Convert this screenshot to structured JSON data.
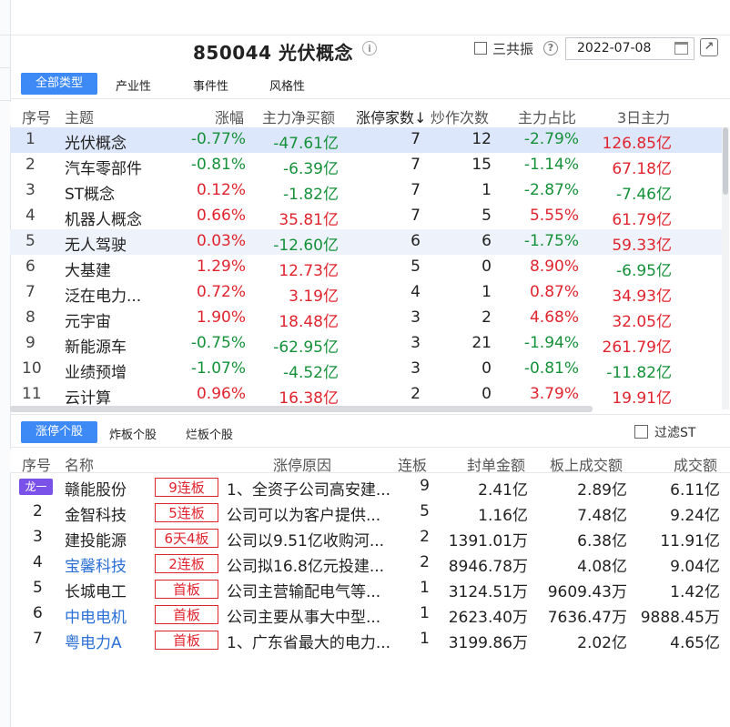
{
  "header": {
    "title": "850044 光伏概念",
    "resonance_label": "三共振",
    "date": "2022-07-08"
  },
  "type_tabs": [
    "全部类型",
    "产业性",
    "事件性",
    "风格性"
  ],
  "concept_table": {
    "columns": [
      "序号",
      "主题",
      "涨幅",
      "主力净买额",
      "涨停家数↓",
      "炒作次数",
      "主力占比",
      "3日主力"
    ],
    "rows": [
      {
        "idx": "1",
        "name": "光伏概念",
        "chg": "-0.77%",
        "net": "-47.61亿",
        "limit_up": "7",
        "hype": "12",
        "ratio": "-2.79%",
        "d3": "126.85亿"
      },
      {
        "idx": "2",
        "name": "汽车零部件",
        "chg": "-0.81%",
        "net": "-6.39亿",
        "limit_up": "7",
        "hype": "15",
        "ratio": "-1.14%",
        "d3": "67.18亿"
      },
      {
        "idx": "3",
        "name": "ST概念",
        "chg": "0.12%",
        "net": "-1.82亿",
        "limit_up": "7",
        "hype": "1",
        "ratio": "-2.87%",
        "d3": "-7.46亿"
      },
      {
        "idx": "4",
        "name": "机器人概念",
        "chg": "0.66%",
        "net": "35.81亿",
        "limit_up": "7",
        "hype": "5",
        "ratio": "5.55%",
        "d3": "61.79亿"
      },
      {
        "idx": "5",
        "name": "无人驾驶",
        "chg": "0.03%",
        "net": "-12.60亿",
        "limit_up": "6",
        "hype": "6",
        "ratio": "-1.75%",
        "d3": "59.33亿"
      },
      {
        "idx": "6",
        "name": "大基建",
        "chg": "1.29%",
        "net": "12.73亿",
        "limit_up": "5",
        "hype": "0",
        "ratio": "8.90%",
        "d3": "-6.95亿"
      },
      {
        "idx": "7",
        "name": "泛在电力...",
        "chg": "0.72%",
        "net": "3.19亿",
        "limit_up": "4",
        "hype": "1",
        "ratio": "0.87%",
        "d3": "34.93亿"
      },
      {
        "idx": "8",
        "name": "元宇宙",
        "chg": "1.90%",
        "net": "18.48亿",
        "limit_up": "3",
        "hype": "2",
        "ratio": "4.68%",
        "d3": "32.05亿"
      },
      {
        "idx": "9",
        "name": "新能源车",
        "chg": "-0.75%",
        "net": "-62.95亿",
        "limit_up": "3",
        "hype": "21",
        "ratio": "-1.94%",
        "d3": "261.79亿"
      },
      {
        "idx": "10",
        "name": "业绩预增",
        "chg": "-1.07%",
        "net": "-4.52亿",
        "limit_up": "3",
        "hype": "0",
        "ratio": "-0.81%",
        "d3": "-11.82亿"
      },
      {
        "idx": "11",
        "name": "云计算",
        "chg": "0.96%",
        "net": "16.38亿",
        "limit_up": "2",
        "hype": "0",
        "ratio": "3.79%",
        "d3": "19.91亿"
      }
    ]
  },
  "stock_tabs": [
    "涨停个股",
    "炸板个股",
    "烂板个股"
  ],
  "filter_st_label": "过滤ST",
  "stock_table": {
    "columns": [
      "序号",
      "名称",
      "涨停原因",
      "连板",
      "封单金额",
      "板上成交额",
      "成交额"
    ],
    "rows": [
      {
        "idx": "龙一",
        "name": "赣能股份",
        "badge": "9连板",
        "reason": "1、全资子公司高安建...",
        "boards": "9",
        "seal": "2.41亿",
        "on_board": "2.89亿",
        "turnover": "6.11亿"
      },
      {
        "idx": "2",
        "name": "金智科技",
        "badge": "5连板",
        "reason": "公司可以为客户提供...",
        "boards": "5",
        "seal": "1.16亿",
        "on_board": "7.48亿",
        "turnover": "9.24亿"
      },
      {
        "idx": "3",
        "name": "建投能源",
        "badge": "6天4板",
        "reason": "公司以9.51亿收购河...",
        "boards": "2",
        "seal": "1391.01万",
        "on_board": "6.38亿",
        "turnover": "11.91亿"
      },
      {
        "idx": "4",
        "name": "宝馨科技",
        "badge": "2连板",
        "reason": "公司拟16.8亿元投建...",
        "boards": "2",
        "seal": "8946.78万",
        "on_board": "4.08亿",
        "turnover": "9.04亿"
      },
      {
        "idx": "5",
        "name": "长城电工",
        "badge": "首板",
        "reason": "公司主营输配电气等...",
        "boards": "1",
        "seal": "3124.51万",
        "on_board": "9609.43万",
        "turnover": "1.42亿"
      },
      {
        "idx": "6",
        "name": "中电电机",
        "badge": "首板",
        "reason": "公司主要从事大中型...",
        "boards": "1",
        "seal": "2623.40万",
        "on_board": "7636.47万",
        "turnover": "9888.45万"
      },
      {
        "idx": "7",
        "name": "粤电力A",
        "badge": "首板",
        "reason": "1、广东省最大的电力...",
        "boards": "1",
        "seal": "3199.86万",
        "on_board": "2.02亿",
        "turnover": "4.65亿"
      }
    ]
  },
  "colors": {
    "up": "#e0242e",
    "down": "#15913a",
    "accent": "#3d8af7",
    "dragon": "#7b52e9",
    "link": "#2a6fd6"
  }
}
